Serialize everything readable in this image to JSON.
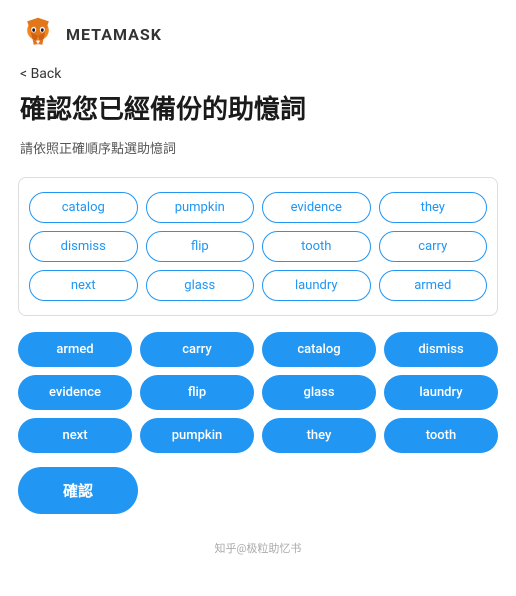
{
  "header": {
    "logo_alt": "MetaMask Fox Logo",
    "brand_name": "METAMASK"
  },
  "nav": {
    "back_label": "< Back"
  },
  "page": {
    "title": "確認您已經備份的助憶詞",
    "subtitle": "請依照正確順序點選助憶詞"
  },
  "word_pool": {
    "words": [
      {
        "id": "catalog",
        "label": "catalog"
      },
      {
        "id": "pumpkin",
        "label": "pumpkin"
      },
      {
        "id": "evidence",
        "label": "evidence"
      },
      {
        "id": "they",
        "label": "they"
      },
      {
        "id": "dismiss",
        "label": "dismiss"
      },
      {
        "id": "flip",
        "label": "flip"
      },
      {
        "id": "tooth",
        "label": "tooth"
      },
      {
        "id": "carry",
        "label": "carry"
      },
      {
        "id": "next",
        "label": "next"
      },
      {
        "id": "glass",
        "label": "glass"
      },
      {
        "id": "laundry",
        "label": "laundry"
      },
      {
        "id": "armed",
        "label": "armed"
      }
    ]
  },
  "selected_words": {
    "words": [
      {
        "id": "armed",
        "label": "armed"
      },
      {
        "id": "carry",
        "label": "carry"
      },
      {
        "id": "catalog",
        "label": "catalog"
      },
      {
        "id": "dismiss",
        "label": "dismiss"
      },
      {
        "id": "evidence",
        "label": "evidence"
      },
      {
        "id": "flip",
        "label": "flip"
      },
      {
        "id": "glass",
        "label": "glass"
      },
      {
        "id": "laundry",
        "label": "laundry"
      },
      {
        "id": "next",
        "label": "next"
      },
      {
        "id": "pumpkin",
        "label": "pumpkin"
      },
      {
        "id": "they",
        "label": "they"
      },
      {
        "id": "tooth",
        "label": "tooth"
      }
    ]
  },
  "footer": {
    "confirm_button": "確認",
    "watermark": "知乎@极粒助忆书"
  }
}
